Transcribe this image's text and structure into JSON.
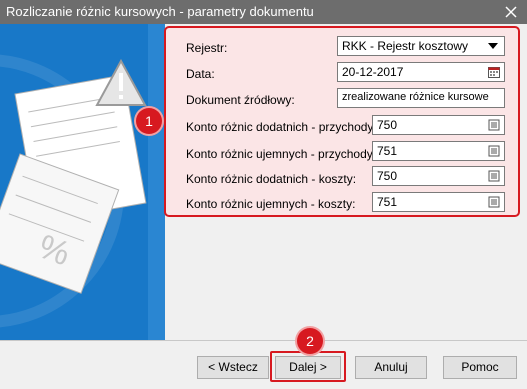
{
  "window": {
    "title": "Rozliczanie różnic kursowych - parametry dokumentu"
  },
  "form": {
    "rejestr_label": "Rejestr:",
    "rejestr_value": "RKK - Rejestr kosztowy",
    "data_label": "Data:",
    "data_value": "20-12-2017",
    "dokument_label": "Dokument źródłowy:",
    "dokument_value": "zrealizowane różnice kursowe",
    "konto_dod_przych_label": "Konto różnic dodatnich - przychody:",
    "konto_dod_przych_value": "750",
    "konto_uj_przych_label": "Konto różnic ujemnych - przychody:",
    "konto_uj_przych_value": "751",
    "konto_dod_koszty_label": "Konto różnic dodatnich - koszty:",
    "konto_dod_koszty_value": "750",
    "konto_uj_koszty_label": "Konto różnic ujemnych - koszty:",
    "konto_uj_koszty_value": "751"
  },
  "badges": {
    "one": "1",
    "two": "2"
  },
  "buttons": {
    "back": "< Wstecz",
    "next": "Dalej >",
    "cancel": "Anuluj",
    "help": "Pomoc"
  },
  "colors": {
    "accent": "#d71920",
    "sidebar": "#1878c8",
    "titlebar": "#6d6d6d"
  },
  "icons": [
    "close-icon",
    "warning-icon",
    "document-icon",
    "calendar-icon",
    "list-icon",
    "chevron-down-icon"
  ]
}
